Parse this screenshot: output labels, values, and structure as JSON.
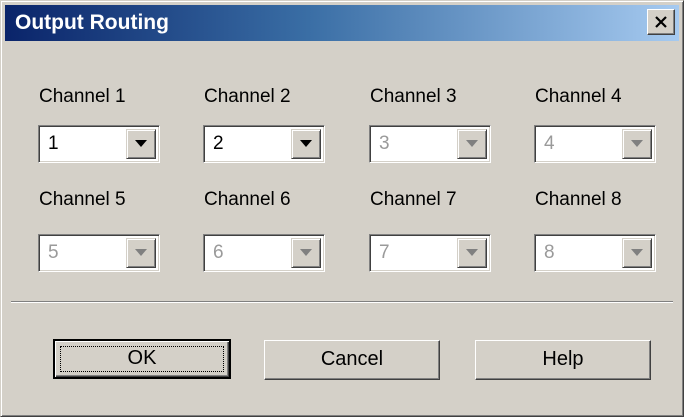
{
  "window": {
    "title": "Output Routing"
  },
  "channels": [
    {
      "label": "Channel 1",
      "value": "1",
      "enabled": true
    },
    {
      "label": "Channel 2",
      "value": "2",
      "enabled": true
    },
    {
      "label": "Channel 3",
      "value": "3",
      "enabled": false
    },
    {
      "label": "Channel 4",
      "value": "4",
      "enabled": false
    },
    {
      "label": "Channel 5",
      "value": "5",
      "enabled": false
    },
    {
      "label": "Channel 6",
      "value": "6",
      "enabled": false
    },
    {
      "label": "Channel 7",
      "value": "7",
      "enabled": false
    },
    {
      "label": "Channel 8",
      "value": "8",
      "enabled": false
    }
  ],
  "buttons": {
    "ok": "OK",
    "cancel": "Cancel",
    "help": "Help"
  },
  "icons": {
    "close": "close-icon",
    "dropdown": "chevron-down-icon"
  },
  "colors": {
    "titlebar_start": "#0a246a",
    "titlebar_end": "#a6caf0",
    "face": "#d4d0c8",
    "disabled_text": "#9a9a9a"
  }
}
